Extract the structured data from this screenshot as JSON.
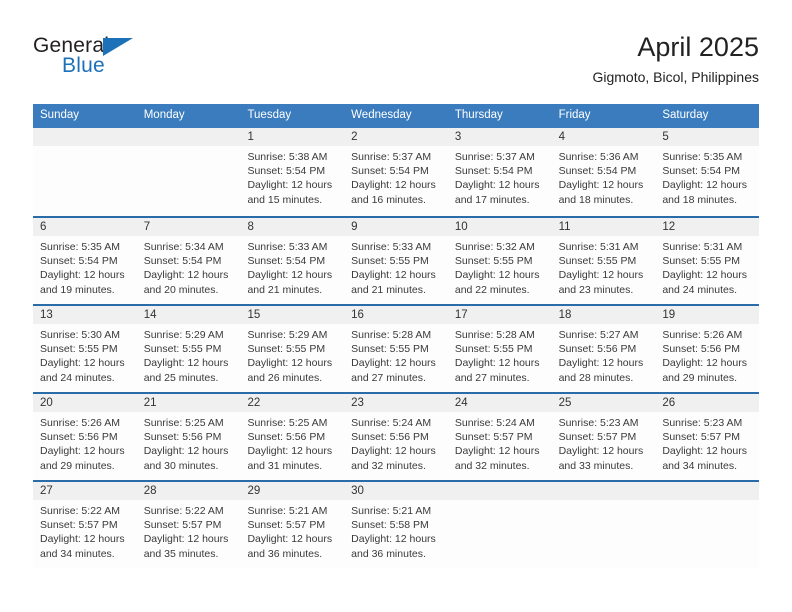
{
  "logo": {
    "line1": "General",
    "line2": "Blue",
    "triangle_color": "#1d71b8",
    "text_color": "#231f20"
  },
  "header": {
    "title": "April 2025",
    "subtitle": "Gigmoto, Bicol, Philippines"
  },
  "colors": {
    "weekday_header_bg": "#3a7cbd",
    "weekday_header_text": "#ffffff",
    "row_divider": "#2a6ca8",
    "day_number_bg": "#f0f0f0",
    "body_text": "#3a3a3a"
  },
  "weekdays": [
    "Sunday",
    "Monday",
    "Tuesday",
    "Wednesday",
    "Thursday",
    "Friday",
    "Saturday"
  ],
  "weeks": [
    [
      {
        "day": "",
        "empty": true,
        "sunrise": "",
        "sunset": "",
        "daylight_line1": "",
        "daylight_line2": ""
      },
      {
        "day": "",
        "empty": true,
        "sunrise": "",
        "sunset": "",
        "daylight_line1": "",
        "daylight_line2": ""
      },
      {
        "day": "1",
        "sunrise": "Sunrise: 5:38 AM",
        "sunset": "Sunset: 5:54 PM",
        "daylight_line1": "Daylight: 12 hours",
        "daylight_line2": "and 15 minutes."
      },
      {
        "day": "2",
        "sunrise": "Sunrise: 5:37 AM",
        "sunset": "Sunset: 5:54 PM",
        "daylight_line1": "Daylight: 12 hours",
        "daylight_line2": "and 16 minutes."
      },
      {
        "day": "3",
        "sunrise": "Sunrise: 5:37 AM",
        "sunset": "Sunset: 5:54 PM",
        "daylight_line1": "Daylight: 12 hours",
        "daylight_line2": "and 17 minutes."
      },
      {
        "day": "4",
        "sunrise": "Sunrise: 5:36 AM",
        "sunset": "Sunset: 5:54 PM",
        "daylight_line1": "Daylight: 12 hours",
        "daylight_line2": "and 18 minutes."
      },
      {
        "day": "5",
        "sunrise": "Sunrise: 5:35 AM",
        "sunset": "Sunset: 5:54 PM",
        "daylight_line1": "Daylight: 12 hours",
        "daylight_line2": "and 18 minutes."
      }
    ],
    [
      {
        "day": "6",
        "sunrise": "Sunrise: 5:35 AM",
        "sunset": "Sunset: 5:54 PM",
        "daylight_line1": "Daylight: 12 hours",
        "daylight_line2": "and 19 minutes."
      },
      {
        "day": "7",
        "sunrise": "Sunrise: 5:34 AM",
        "sunset": "Sunset: 5:54 PM",
        "daylight_line1": "Daylight: 12 hours",
        "daylight_line2": "and 20 minutes."
      },
      {
        "day": "8",
        "sunrise": "Sunrise: 5:33 AM",
        "sunset": "Sunset: 5:54 PM",
        "daylight_line1": "Daylight: 12 hours",
        "daylight_line2": "and 21 minutes."
      },
      {
        "day": "9",
        "sunrise": "Sunrise: 5:33 AM",
        "sunset": "Sunset: 5:55 PM",
        "daylight_line1": "Daylight: 12 hours",
        "daylight_line2": "and 21 minutes."
      },
      {
        "day": "10",
        "sunrise": "Sunrise: 5:32 AM",
        "sunset": "Sunset: 5:55 PM",
        "daylight_line1": "Daylight: 12 hours",
        "daylight_line2": "and 22 minutes."
      },
      {
        "day": "11",
        "sunrise": "Sunrise: 5:31 AM",
        "sunset": "Sunset: 5:55 PM",
        "daylight_line1": "Daylight: 12 hours",
        "daylight_line2": "and 23 minutes."
      },
      {
        "day": "12",
        "sunrise": "Sunrise: 5:31 AM",
        "sunset": "Sunset: 5:55 PM",
        "daylight_line1": "Daylight: 12 hours",
        "daylight_line2": "and 24 minutes."
      }
    ],
    [
      {
        "day": "13",
        "sunrise": "Sunrise: 5:30 AM",
        "sunset": "Sunset: 5:55 PM",
        "daylight_line1": "Daylight: 12 hours",
        "daylight_line2": "and 24 minutes."
      },
      {
        "day": "14",
        "sunrise": "Sunrise: 5:29 AM",
        "sunset": "Sunset: 5:55 PM",
        "daylight_line1": "Daylight: 12 hours",
        "daylight_line2": "and 25 minutes."
      },
      {
        "day": "15",
        "sunrise": "Sunrise: 5:29 AM",
        "sunset": "Sunset: 5:55 PM",
        "daylight_line1": "Daylight: 12 hours",
        "daylight_line2": "and 26 minutes."
      },
      {
        "day": "16",
        "sunrise": "Sunrise: 5:28 AM",
        "sunset": "Sunset: 5:55 PM",
        "daylight_line1": "Daylight: 12 hours",
        "daylight_line2": "and 27 minutes."
      },
      {
        "day": "17",
        "sunrise": "Sunrise: 5:28 AM",
        "sunset": "Sunset: 5:55 PM",
        "daylight_line1": "Daylight: 12 hours",
        "daylight_line2": "and 27 minutes."
      },
      {
        "day": "18",
        "sunrise": "Sunrise: 5:27 AM",
        "sunset": "Sunset: 5:56 PM",
        "daylight_line1": "Daylight: 12 hours",
        "daylight_line2": "and 28 minutes."
      },
      {
        "day": "19",
        "sunrise": "Sunrise: 5:26 AM",
        "sunset": "Sunset: 5:56 PM",
        "daylight_line1": "Daylight: 12 hours",
        "daylight_line2": "and 29 minutes."
      }
    ],
    [
      {
        "day": "20",
        "sunrise": "Sunrise: 5:26 AM",
        "sunset": "Sunset: 5:56 PM",
        "daylight_line1": "Daylight: 12 hours",
        "daylight_line2": "and 29 minutes."
      },
      {
        "day": "21",
        "sunrise": "Sunrise: 5:25 AM",
        "sunset": "Sunset: 5:56 PM",
        "daylight_line1": "Daylight: 12 hours",
        "daylight_line2": "and 30 minutes."
      },
      {
        "day": "22",
        "sunrise": "Sunrise: 5:25 AM",
        "sunset": "Sunset: 5:56 PM",
        "daylight_line1": "Daylight: 12 hours",
        "daylight_line2": "and 31 minutes."
      },
      {
        "day": "23",
        "sunrise": "Sunrise: 5:24 AM",
        "sunset": "Sunset: 5:56 PM",
        "daylight_line1": "Daylight: 12 hours",
        "daylight_line2": "and 32 minutes."
      },
      {
        "day": "24",
        "sunrise": "Sunrise: 5:24 AM",
        "sunset": "Sunset: 5:57 PM",
        "daylight_line1": "Daylight: 12 hours",
        "daylight_line2": "and 32 minutes."
      },
      {
        "day": "25",
        "sunrise": "Sunrise: 5:23 AM",
        "sunset": "Sunset: 5:57 PM",
        "daylight_line1": "Daylight: 12 hours",
        "daylight_line2": "and 33 minutes."
      },
      {
        "day": "26",
        "sunrise": "Sunrise: 5:23 AM",
        "sunset": "Sunset: 5:57 PM",
        "daylight_line1": "Daylight: 12 hours",
        "daylight_line2": "and 34 minutes."
      }
    ],
    [
      {
        "day": "27",
        "sunrise": "Sunrise: 5:22 AM",
        "sunset": "Sunset: 5:57 PM",
        "daylight_line1": "Daylight: 12 hours",
        "daylight_line2": "and 34 minutes."
      },
      {
        "day": "28",
        "sunrise": "Sunrise: 5:22 AM",
        "sunset": "Sunset: 5:57 PM",
        "daylight_line1": "Daylight: 12 hours",
        "daylight_line2": "and 35 minutes."
      },
      {
        "day": "29",
        "sunrise": "Sunrise: 5:21 AM",
        "sunset": "Sunset: 5:57 PM",
        "daylight_line1": "Daylight: 12 hours",
        "daylight_line2": "and 36 minutes."
      },
      {
        "day": "30",
        "sunrise": "Sunrise: 5:21 AM",
        "sunset": "Sunset: 5:58 PM",
        "daylight_line1": "Daylight: 12 hours",
        "daylight_line2": "and 36 minutes."
      },
      {
        "day": "",
        "empty": true,
        "sunrise": "",
        "sunset": "",
        "daylight_line1": "",
        "daylight_line2": ""
      },
      {
        "day": "",
        "empty": true,
        "sunrise": "",
        "sunset": "",
        "daylight_line1": "",
        "daylight_line2": ""
      },
      {
        "day": "",
        "empty": true,
        "sunrise": "",
        "sunset": "",
        "daylight_line1": "",
        "daylight_line2": ""
      }
    ]
  ]
}
